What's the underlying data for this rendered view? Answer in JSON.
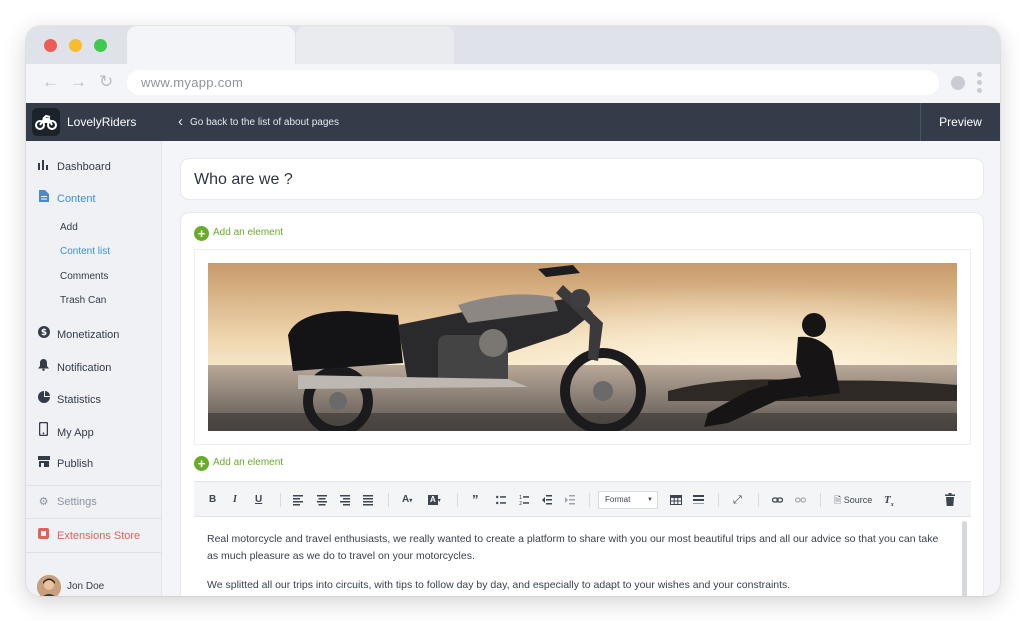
{
  "browser": {
    "url": "www.myapp.com"
  },
  "header": {
    "brand": "LovelyRiders",
    "back_link": "Go back to the list of about pages",
    "preview_label": "Preview"
  },
  "sidebar": {
    "dashboard": "Dashboard",
    "content": "Content",
    "content_sub": [
      "Add",
      "Content list",
      "Comments",
      "Trash Can"
    ],
    "monetization": "Monetization",
    "notification": "Notification",
    "statistics": "Statistics",
    "myapp": "My App",
    "publish": "Publish",
    "settings": "Settings",
    "extensions": "Extensions Store",
    "user_name": "Jon Doe"
  },
  "main": {
    "page_title": "Who are we ?",
    "add_element_label": "Add an element",
    "toolbar": {
      "format_label": "Format",
      "source_label": "Source"
    },
    "paragraphs": [
      "Real motorcycle and travel enthusiasts,  we really wanted to create a platform to share with you our most beautiful trips and all our advice so that you can take as much pleasure as we do to travel on your motorcycles.",
      "We splitted all our trips into circuits, with tips to follow day by day, and especially to adapt to your wishes and your constraints."
    ]
  },
  "colors": {
    "accent": "#3e8fd8",
    "header_bg": "#333c48",
    "add_green": "#6aab2c",
    "extensions_red": "#e4605a"
  }
}
